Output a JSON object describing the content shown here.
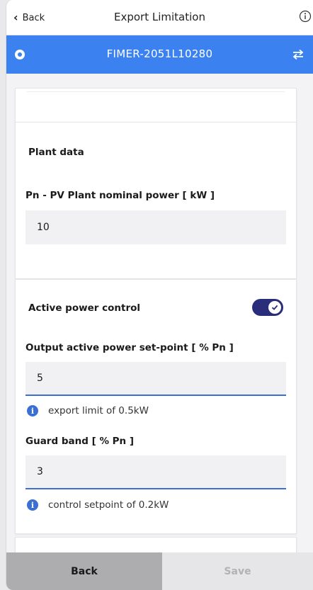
{
  "nav": {
    "back_label": "Back",
    "title": "Export Limitation",
    "info_icon": "info-circle-icon"
  },
  "device_bar": {
    "name": "FIMER-2051L10280",
    "color": "#3b82f0",
    "left_icon": "radio-dot-icon",
    "right_icon": "swap-arrows-icon"
  },
  "plant_data": {
    "section_title": "Plant data",
    "nominal_power_label": "Pn - PV Plant nominal power [ kW ]",
    "nominal_power_value": "10"
  },
  "active_power": {
    "toggle_label": "Active power control",
    "toggle_on": true,
    "toggle_color": "#2a2e7a",
    "setpoint_label": "Output active power set-point [ % Pn ]",
    "setpoint_value": "5",
    "setpoint_hint": "export limit of 0.5kW",
    "guard_label": "Guard band [ % Pn ]",
    "guard_value": "3",
    "guard_hint": "control setpoint of 0.2kW"
  },
  "footer": {
    "back_label": "Back",
    "save_label": "Save"
  }
}
